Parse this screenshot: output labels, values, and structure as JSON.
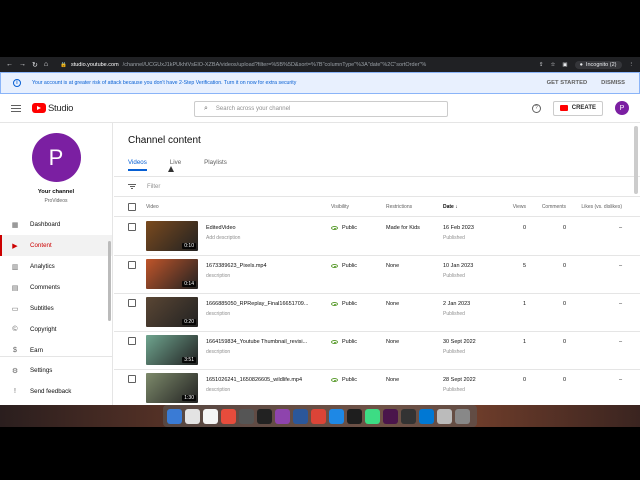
{
  "browser": {
    "url_host": "studio.youtube.com",
    "url_path": "/channel/UCGUxJ1kPUkhtVsElO-XZBA/videos/upload?filter=%5B%5D&sort=%7B\"columnType\"%3A\"date\"%2C\"sortOrder\"%",
    "incognito_label": "Incognito (2)"
  },
  "banner": {
    "message": "Your account is at greater risk of attack because you don't have 2-Step Verification. Turn it on now for extra security",
    "get_started": "GET STARTED",
    "dismiss": "DISMISS"
  },
  "topbar": {
    "logo_text": "Studio",
    "search_placeholder": "Search across your channel",
    "create_label": "CREATE",
    "avatar_letter": "P"
  },
  "sidebar": {
    "avatar_letter": "P",
    "channel_label": "Your channel",
    "channel_name": "ProVideos",
    "items": [
      {
        "label": "Dashboard",
        "icon": "dashboard-icon"
      },
      {
        "label": "Content",
        "icon": "content-icon",
        "active": true
      },
      {
        "label": "Analytics",
        "icon": "analytics-icon"
      },
      {
        "label": "Comments",
        "icon": "comments-icon"
      },
      {
        "label": "Subtitles",
        "icon": "subtitles-icon"
      },
      {
        "label": "Copyright",
        "icon": "copyright-icon"
      },
      {
        "label": "Earn",
        "icon": "earn-icon"
      }
    ],
    "footer": [
      {
        "label": "Settings",
        "icon": "gear-icon"
      },
      {
        "label": "Send feedback",
        "icon": "feedback-icon"
      }
    ]
  },
  "main": {
    "title": "Channel content",
    "tabs": [
      "Videos",
      "Live",
      "Playlists"
    ],
    "filter_placeholder": "Filter",
    "columns": {
      "video": "Video",
      "visibility": "Visibility",
      "restrictions": "Restrictions",
      "date": "Date",
      "views": "Views",
      "comments": "Comments",
      "likes": "Likes (vs. dislikes)"
    },
    "rows": [
      {
        "title": "EditedVideo",
        "desc": "Add description",
        "duration": "0:10",
        "visibility": "Public",
        "restrictions": "Made for Kids",
        "date": "16 Feb 2023",
        "status": "Published",
        "views": "0",
        "comments": "0",
        "likes": "–",
        "thumb_color": "#7a4a1e"
      },
      {
        "title": "1673389623_Pixels.mp4",
        "desc": "description",
        "duration": "0:14",
        "visibility": "Public",
        "restrictions": "None",
        "date": "10 Jan 2023",
        "status": "Published",
        "views": "5",
        "comments": "0",
        "likes": "–",
        "thumb_color": "#c0552a"
      },
      {
        "title": "1666885050_RPReplay_Final16651709...",
        "desc": "description",
        "duration": "0:20",
        "visibility": "Public",
        "restrictions": "None",
        "date": "2 Jan 2023",
        "status": "Published",
        "views": "1",
        "comments": "0",
        "likes": "–",
        "thumb_color": "#5a4634"
      },
      {
        "title": "1664159834_Youtube Thumbnail_revisi...",
        "desc": "description",
        "duration": "3:51",
        "visibility": "Public",
        "restrictions": "None",
        "date": "30 Sept 2022",
        "status": "Published",
        "views": "1",
        "comments": "0",
        "likes": "–",
        "thumb_color": "#6fa58f"
      },
      {
        "title": "1651026241_1650826605_wildlife.mp4",
        "desc": "description",
        "duration": "1:30",
        "visibility": "Public",
        "restrictions": "None",
        "date": "28 Sept 2022",
        "status": "Published",
        "views": "0",
        "comments": "0",
        "likes": "–",
        "thumb_color": "#7d8a6b"
      }
    ]
  }
}
